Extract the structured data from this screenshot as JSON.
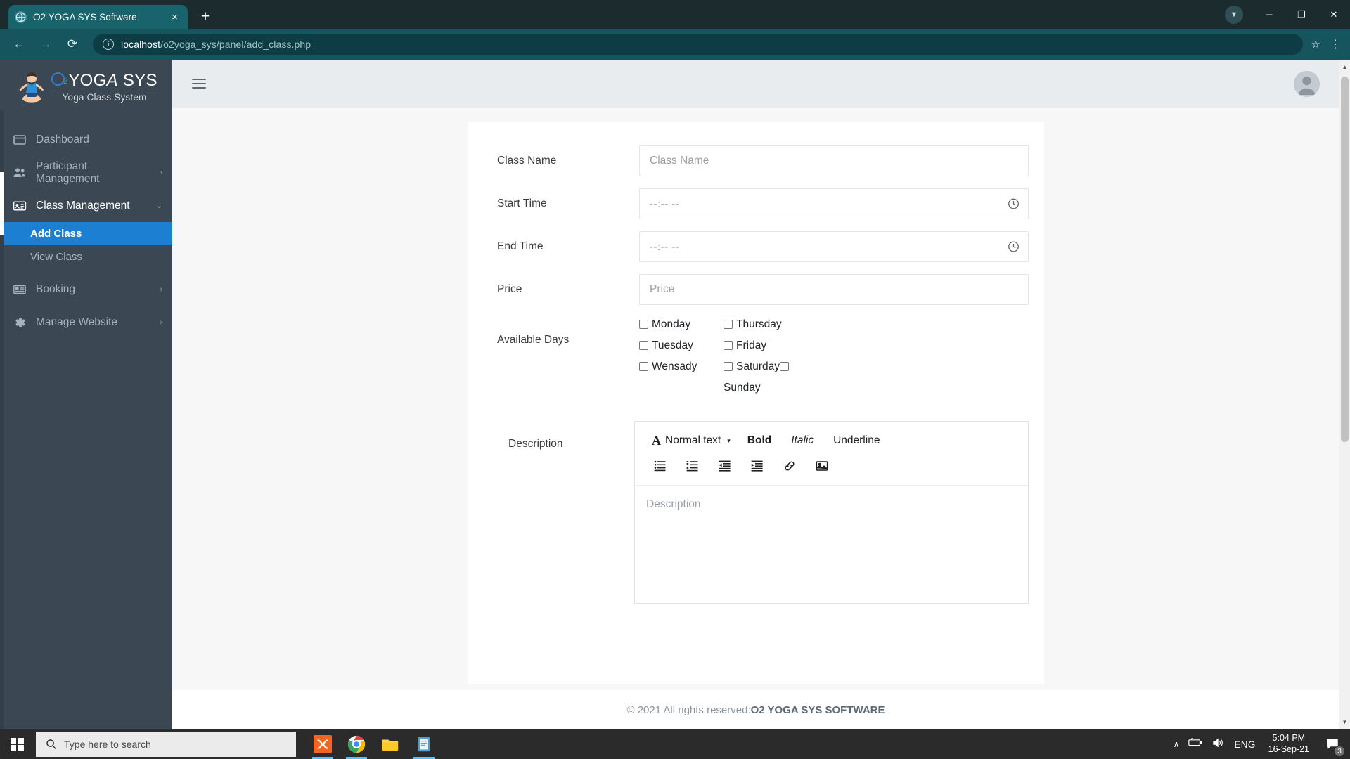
{
  "browser": {
    "tab_title": "O2 YOGA SYS Software",
    "tab_close_label": "×",
    "new_tab_label": "+",
    "url_host": "localhost",
    "url_path": "/o2yoga_sys/panel/add_class.php",
    "back_label": "←",
    "forward_label": "→",
    "reload_label": "⟳",
    "star_label": "☆",
    "menu_label": "⋮",
    "minimize_label": "─",
    "maximize_label": "❐",
    "close_label": "✕",
    "update_label": "▼"
  },
  "sidebar": {
    "brand": {
      "o2_sub": "2",
      "name_primary": "YOG",
      "name_italic": "A",
      "name_suffix": " SYS",
      "tagline": "Yoga Class System"
    },
    "items": [
      {
        "label": "Dashboard",
        "icon": "window-icon",
        "has_caret": false
      },
      {
        "label": "Participant Management",
        "icon": "users-icon",
        "has_caret": true,
        "caret": "›"
      },
      {
        "label": "Class Management",
        "icon": "id-card-icon",
        "has_caret": true,
        "caret": "⌄",
        "active": true
      },
      {
        "label": "Booking",
        "icon": "newspaper-icon",
        "has_caret": true,
        "caret": "›"
      },
      {
        "label": "Manage Website",
        "icon": "gear-icon",
        "has_caret": true,
        "caret": "›"
      }
    ],
    "subitems": [
      {
        "label": "Add Class",
        "active": true
      },
      {
        "label": "View Class",
        "active": false
      }
    ]
  },
  "topbar": {
    "menu_toggle": "hamburger-icon"
  },
  "form": {
    "fields": [
      {
        "label": "Class Name",
        "placeholder": "Class Name",
        "type": "text"
      },
      {
        "label": "Start Time",
        "placeholder": "--:-- --",
        "type": "time"
      },
      {
        "label": "End Time",
        "placeholder": "--:-- --",
        "type": "time"
      },
      {
        "label": "Price",
        "placeholder": "Price",
        "type": "text"
      }
    ],
    "available_days": {
      "label": "Available Days",
      "column_left": [
        "Monday",
        "Tuesday",
        "Wensady"
      ],
      "column_right": [
        "Thursday",
        "Friday",
        "Saturday"
      ],
      "wrapped": "Sunday"
    },
    "description": {
      "label": "Description",
      "placeholder": "Description",
      "toolbar": {
        "style_glyph": "A",
        "style_label": "Normal text",
        "style_caret": "▾",
        "bold": "Bold",
        "italic": "Italic",
        "underline": "Underline",
        "icons": [
          "bulleted-list-icon",
          "numbered-list-icon",
          "outdent-icon",
          "indent-icon",
          "link-icon",
          "image-icon"
        ]
      }
    }
  },
  "footer": {
    "copyright": "© 2021 All rights reserved: ",
    "brand": "O2 YOGA SYS SOFTWARE"
  },
  "taskbar": {
    "search_placeholder": "Type here to search",
    "apps": [
      "xampp-icon",
      "chrome-icon",
      "file-explorer-icon",
      "notepad-icon"
    ],
    "tray": {
      "chevron": "∧",
      "battery": "battery-icon",
      "volume": "volume-icon",
      "language": "ENG",
      "time": "5:04 PM",
      "date": "16-Sep-21",
      "notification_count": "3"
    }
  },
  "colors": {
    "accent": "#1d7fd1",
    "sidebar": "#3b4752",
    "browser_chrome": "#16555e",
    "tab": "#18636c"
  }
}
